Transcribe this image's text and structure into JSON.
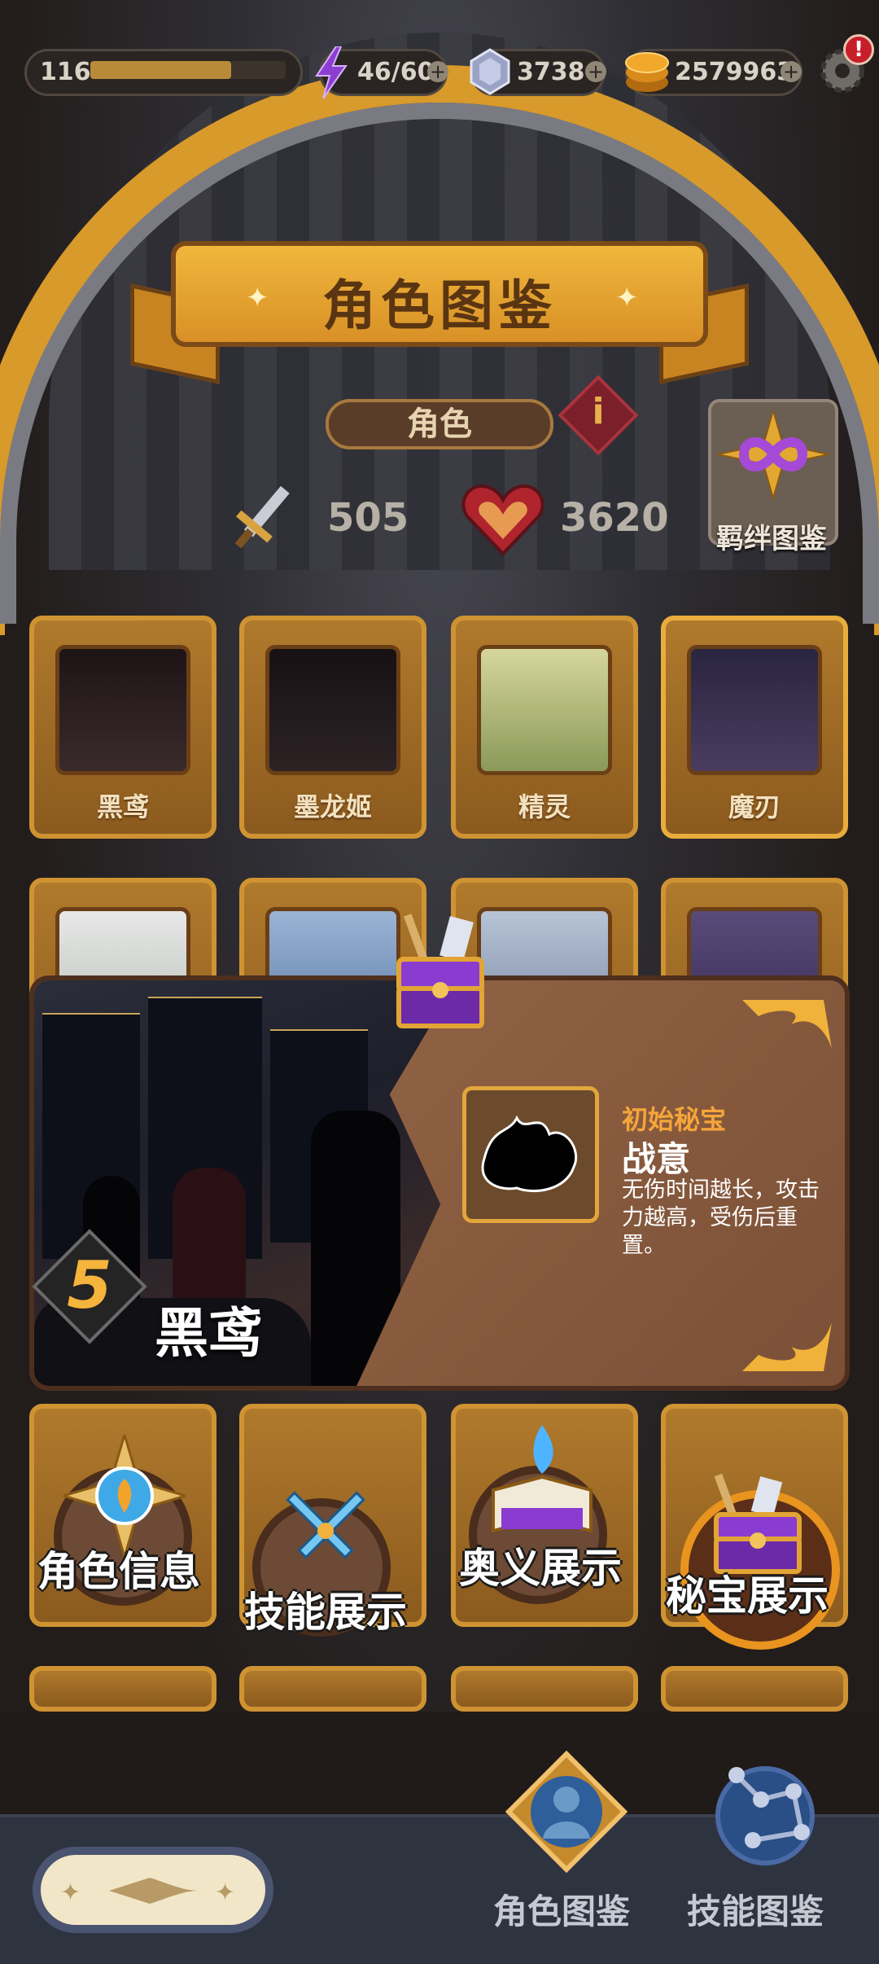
{
  "top_bar": {
    "level": "116",
    "level_progress": 0.72,
    "energy": "46/60",
    "gems": "3738",
    "gold": "2579963",
    "notification_badge": "!"
  },
  "header": {
    "title": "角色图鉴",
    "tab_label": "角色",
    "info_label": "i"
  },
  "stats": {
    "attack": "505",
    "health": "3620",
    "bond_label": "羁绊图鉴"
  },
  "characters": [
    {
      "name": "黑鸢",
      "color": "#3a2a2c"
    },
    {
      "name": "墨龙姬",
      "color": "#2c2224"
    },
    {
      "name": "精灵",
      "color": "#a9b46a"
    },
    {
      "name": "魔刃",
      "color": "#2f2a3e"
    }
  ],
  "popup": {
    "rank": "5",
    "character_name": "黑鸢",
    "treasure_kicker": "初始秘宝",
    "treasure_name": "战意",
    "treasure_desc": "无伤时间越长，攻击力越高，受伤后重置。"
  },
  "actions": {
    "info": "角色信息",
    "skills": "技能展示",
    "secret": "奥义展示",
    "treasure": "秘宝展示"
  },
  "bottom_nav": {
    "character_book": "角色图鉴",
    "skill_book": "技能图鉴"
  },
  "colors": {
    "accent": "#d89a2a",
    "popup_bg": "#8a5d41",
    "energy_icon": "#8b3fd1"
  }
}
